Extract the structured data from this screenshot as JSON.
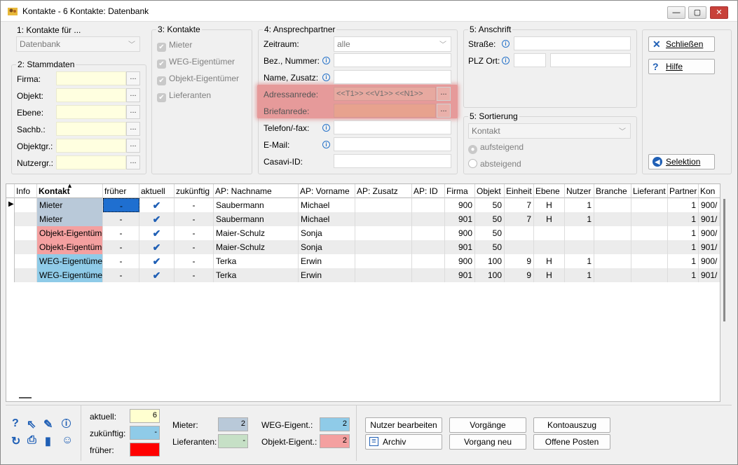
{
  "window": {
    "title": "Kontakte - 6 Kontakte:  Datenbank",
    "min": "—",
    "max": "▢",
    "close": "✕"
  },
  "g1": {
    "title": "1: Kontakte für ...",
    "combo": "Datenbank"
  },
  "g2": {
    "title": "2: Stammdaten",
    "fields": [
      "Firma:",
      "Objekt:",
      "Ebene:",
      "Sachb.:",
      "Objektgr.:",
      "Nutzergr.:"
    ]
  },
  "g3": {
    "title": "3: Kontakte",
    "items": [
      "Mieter",
      "WEG-Eigentümer",
      "Objekt-Eigentümer",
      "Lieferanten"
    ]
  },
  "g4": {
    "title": "4: Ansprechpartner",
    "zeitraum_label": "Zeitraum:",
    "zeitraum_value": "alle",
    "bez": "Bez., Nummer:",
    "name": "Name, Zusatz:",
    "adressanrede": "Adressanrede:",
    "adressanrede_value": "<<T1>> <<V1>> <<N1>>",
    "briefanrede": "Briefanrede:",
    "telefon": "Telefon/-fax:",
    "email": "E-Mail:",
    "casavi": "Casavi-ID:"
  },
  "g5a": {
    "title": "5: Anschrift",
    "strasse": "Straße:",
    "plz": "PLZ Ort:"
  },
  "g5b": {
    "title": "5: Sortierung",
    "combo": "Kontakt",
    "asc": "aufsteigend",
    "desc": "absteigend"
  },
  "buttons": {
    "close": "Schließen",
    "help": "Hilfe",
    "selection": "Selektion"
  },
  "dots": "...",
  "table": {
    "headers": [
      "Info",
      "Kontakt",
      "früher",
      "aktuell",
      "zukünftig",
      "AP: Nachname",
      "AP: Vorname",
      "AP: Zusatz",
      "AP: ID",
      "Firma",
      "Objekt",
      "Einheit",
      "Ebene",
      "Nutzer",
      "Branche",
      "Lieferant",
      "Partner",
      "Kon"
    ],
    "rows": [
      {
        "kontakt": "Mieter",
        "frueher": "-",
        "aktuell": "✔",
        "zukuenftig": "-",
        "nachname": "Saubermann",
        "vorname": "Michael",
        "firma": "900",
        "objekt": "50",
        "einheit": "7",
        "ebene": "H",
        "nutzer": "1",
        "partner": "1",
        "kon": "900/"
      },
      {
        "kontakt": "Mieter",
        "frueher": "-",
        "aktuell": "✔",
        "zukuenftig": "-",
        "nachname": "Saubermann",
        "vorname": "Michael",
        "firma": "901",
        "objekt": "50",
        "einheit": "7",
        "ebene": "H",
        "nutzer": "1",
        "partner": "1",
        "kon": "901/"
      },
      {
        "kontakt": "Objekt-Eigentümer",
        "frueher": "-",
        "aktuell": "✔",
        "zukuenftig": "-",
        "nachname": "Maier-Schulz",
        "vorname": "Sonja",
        "firma": "900",
        "objekt": "50",
        "einheit": "",
        "ebene": "",
        "nutzer": "",
        "partner": "1",
        "kon": "900/"
      },
      {
        "kontakt": "Objekt-Eigentümer",
        "frueher": "-",
        "aktuell": "✔",
        "zukuenftig": "-",
        "nachname": "Maier-Schulz",
        "vorname": "Sonja",
        "firma": "901",
        "objekt": "50",
        "einheit": "",
        "ebene": "",
        "nutzer": "",
        "partner": "1",
        "kon": "901/"
      },
      {
        "kontakt": "WEG-Eigentümer",
        "frueher": "-",
        "aktuell": "✔",
        "zukuenftig": "-",
        "nachname": "Terka",
        "vorname": "Erwin",
        "firma": "900",
        "objekt": "100",
        "einheit": "9",
        "ebene": "H",
        "nutzer": "1",
        "partner": "1",
        "kon": "900/"
      },
      {
        "kontakt": "WEG-Eigentümer",
        "frueher": "-",
        "aktuell": "✔",
        "zukuenftig": "-",
        "nachname": "Terka",
        "vorname": "Erwin",
        "firma": "901",
        "objekt": "100",
        "einheit": "9",
        "ebene": "H",
        "nutzer": "1",
        "partner": "1",
        "kon": "901/"
      }
    ]
  },
  "legend": {
    "aktuell": "aktuell:",
    "aktuell_val": "6",
    "zukuenftig": "zukünftig:",
    "zukuenftig_val": "-",
    "frueher": "früher:",
    "mieter": "Mieter:",
    "mieter_val": "2",
    "lieferanten": "Lieferanten:",
    "lieferanten_val": "-",
    "weg": "WEG-Eigent.:",
    "weg_val": "2",
    "objekt": "Objekt-Eigent.:",
    "objekt_val": "2"
  },
  "actions": {
    "nutzer": "Nutzer bearbeiten",
    "archiv": "Archiv",
    "vorgaenge": "Vorgänge",
    "vorgang_neu": "Vorgang neu",
    "kontoauszug": "Kontoauszug",
    "offene": "Offene Posten"
  },
  "colors": {
    "mieter": "#b9c9d9",
    "objekt": "#f4a0a0",
    "weg": "#8fcbe8",
    "lieferant": "#c6e0c6",
    "aktuell": "#ffffd0",
    "frueher": "#ff0000",
    "highlight": "#e69a9a"
  }
}
